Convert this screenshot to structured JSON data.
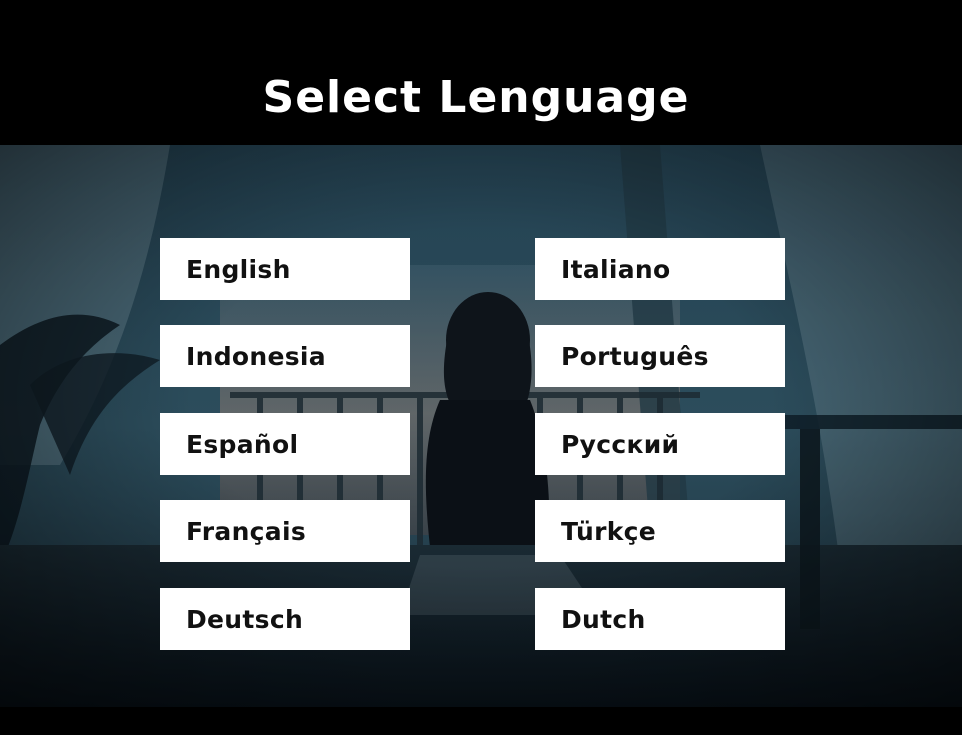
{
  "screen": {
    "title": "Select Lenguage"
  },
  "languages": {
    "left": [
      {
        "label": "English"
      },
      {
        "label": "Indonesia"
      },
      {
        "label": "Español"
      },
      {
        "label": "Français"
      },
      {
        "label": "Deutsch"
      }
    ],
    "right": [
      {
        "label": "Italiano"
      },
      {
        "label": "Português"
      },
      {
        "label": "Русский"
      },
      {
        "label": "Türkçe"
      },
      {
        "label": "Dutch"
      }
    ]
  },
  "colors": {
    "header_bg": "#000000",
    "title_text": "#ffffff",
    "button_bg": "#ffffff",
    "button_text": "#111111"
  }
}
